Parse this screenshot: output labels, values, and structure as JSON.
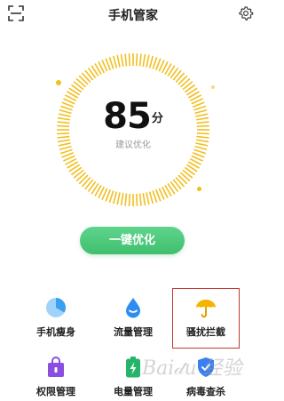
{
  "header": {
    "title": "手机管家",
    "scan_icon": "scan-icon",
    "settings_icon": "gear-icon"
  },
  "score": {
    "value": "85",
    "unit": "分",
    "subtitle": "建议优化",
    "ring_color": "#f2bf1f"
  },
  "optimize_button": {
    "label": "一键优化",
    "color": "#4cc97a"
  },
  "tools": [
    {
      "label": "手机瘦身",
      "icon": "storage-pie-icon",
      "color": "#3aa0f0"
    },
    {
      "label": "流量管理",
      "icon": "water-drop-icon",
      "color": "#2f8df0"
    },
    {
      "label": "骚扰拦截",
      "icon": "umbrella-icon",
      "color": "#f5b400"
    },
    {
      "label": "权限管理",
      "icon": "shopping-bag-icon",
      "color": "#8a4fe0"
    },
    {
      "label": "电量管理",
      "icon": "battery-icon",
      "color": "#26b36a"
    },
    {
      "label": "病毒查杀",
      "icon": "shield-icon",
      "color": "#3a7ff0"
    }
  ],
  "watermark": "Baidu 经验"
}
